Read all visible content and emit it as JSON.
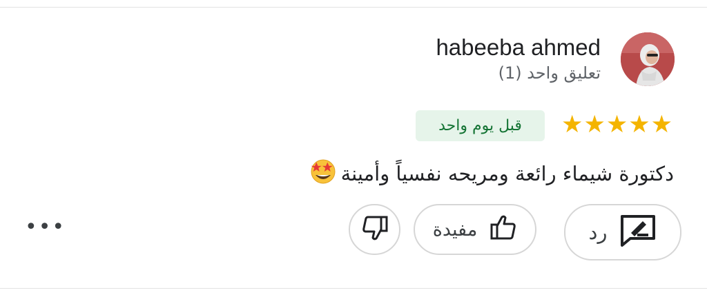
{
  "review": {
    "author": "habeeba ahmed",
    "review_count": "تعليق واحد (1)",
    "rating": 5,
    "time_ago": "قبل يوم واحد",
    "text": "دكتورة شيماء رائعة ومريحه نفسياً وأمينة"
  },
  "actions": {
    "reply_label": "رد",
    "helpful_label": "مفيدة",
    "more_label": "•••"
  },
  "icons": {
    "avatar": "avatar",
    "star": "star-icon",
    "emoji": "star-struck-emoji-icon",
    "reply": "reply-icon",
    "thumbs_up": "thumbs-up-icon",
    "thumbs_down": "thumbs-down-icon",
    "more": "more-icon"
  },
  "colors": {
    "star": "#f4b400",
    "badge_bg": "#e6f4ea",
    "badge_text": "#137333"
  }
}
